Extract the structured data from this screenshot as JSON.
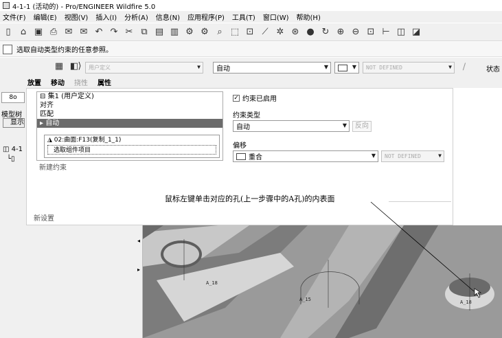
{
  "window": {
    "title": "4-1-1 (活动的) - Pro/ENGINEER Wildfire 5.0"
  },
  "menubar": {
    "items": [
      "文件(F)",
      "编辑(E)",
      "视图(V)",
      "插入(I)",
      "分析(A)",
      "信息(N)",
      "应用程序(P)",
      "工具(T)",
      "窗口(W)",
      "帮助(H)"
    ]
  },
  "hint": {
    "text": "选取自动类型约束的任意参照。"
  },
  "dashboard": {
    "user_defined": "用户定义",
    "constraint_select": "自动",
    "not_defined": "NOT DEFINED",
    "status_label": "状态",
    "tabs": [
      "放置",
      "移动",
      "挠性",
      "属性"
    ]
  },
  "left_panel": {
    "model_tree": "模型树",
    "show": "显示",
    "tree_item": "4-1",
    "tab_glyph": "8o"
  },
  "set_panel": {
    "set_title": "集1 (用户定义)",
    "items": [
      "对齐",
      "匹配",
      "自动"
    ],
    "sub_reference": "02:曲面:F13(复制_1_1)",
    "sub_select": "选取组件项目",
    "new_constraint": "新建约束",
    "new_set": "新设置"
  },
  "options": {
    "enabled_label": "约束已启用",
    "type_label": "约束类型",
    "type_value": "自动",
    "flip": "反向",
    "offset_label": "偏移",
    "offset_value": "重合",
    "offset_not_defined": "NOT DEFINED"
  },
  "viewport": {
    "labels": [
      "A_18",
      "A_15",
      "A_18"
    ]
  },
  "callout": {
    "text": "鼠标左键单击对应的孔(上一步骤中的A孔)的内表面"
  }
}
